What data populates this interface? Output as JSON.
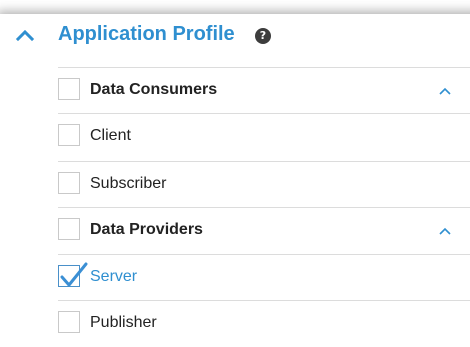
{
  "panel": {
    "title": "Application Profile",
    "help_glyph": "?",
    "expanded": true,
    "accent_color": "#2f8fd0"
  },
  "groups": [
    {
      "label": "Data Consumers",
      "expanded": true,
      "checked": false,
      "items": [
        {
          "label": "Client",
          "checked": false
        },
        {
          "label": "Subscriber",
          "checked": false
        }
      ]
    },
    {
      "label": "Data Providers",
      "expanded": true,
      "checked": false,
      "items": [
        {
          "label": "Server",
          "checked": true
        },
        {
          "label": "Publisher",
          "checked": false
        }
      ]
    }
  ],
  "icons": {
    "collapse": "chevron-up-icon",
    "help": "help-icon",
    "group_toggle": "chevron-up-icon",
    "check": "checkmark-icon"
  }
}
